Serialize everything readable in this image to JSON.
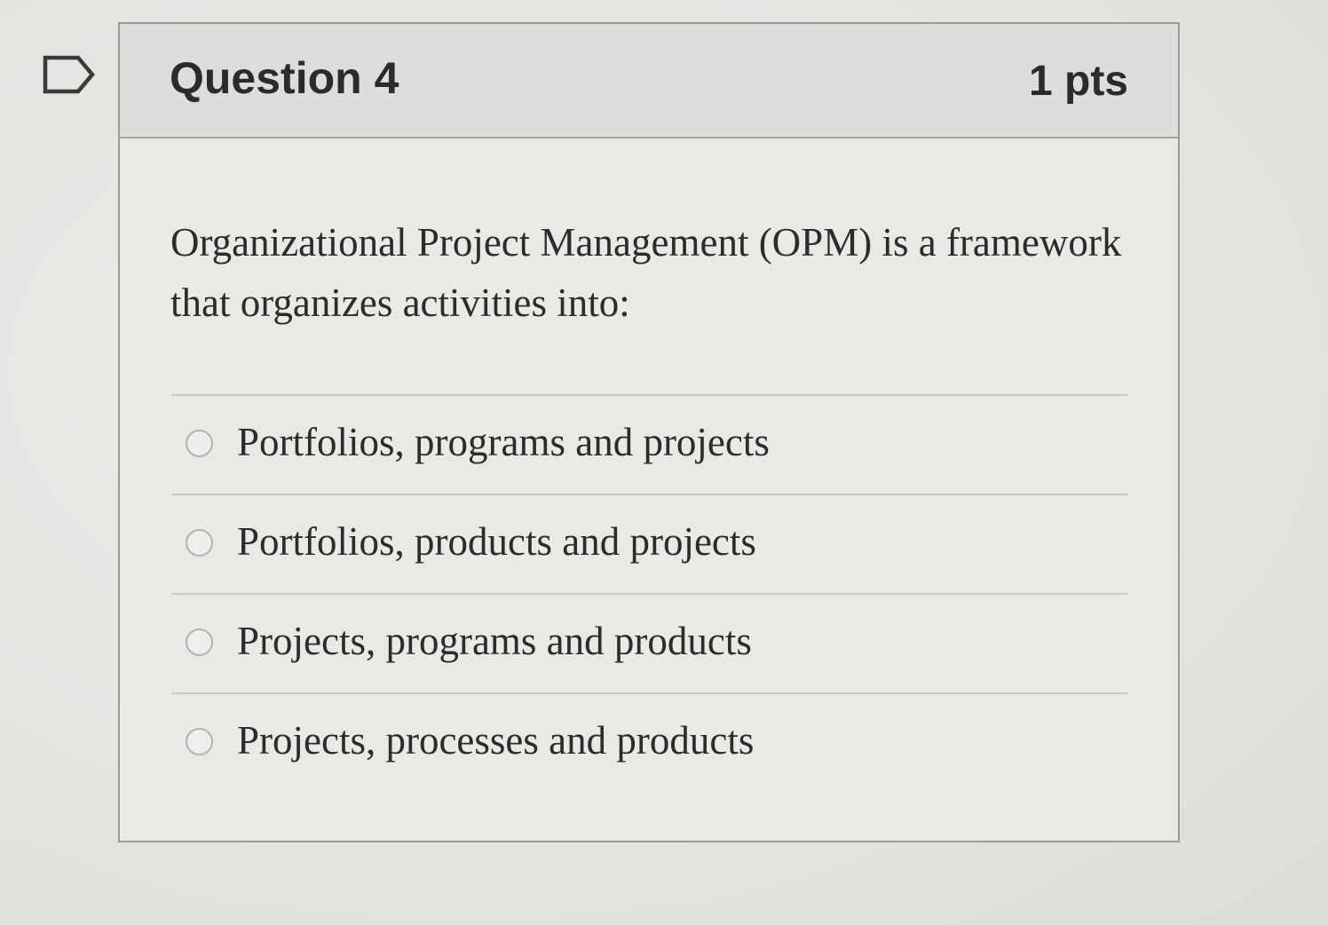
{
  "question": {
    "title": "Question 4",
    "points": "1 pts",
    "text": "Organizational Project Management (OPM) is a framework that organizes activities into:",
    "answers": [
      {
        "label": "Portfolios, programs and projects",
        "selected": false
      },
      {
        "label": "Portfolios, products and projects",
        "selected": false
      },
      {
        "label": "Projects, programs and products",
        "selected": false
      },
      {
        "label": "Projects, processes and products",
        "selected": false
      }
    ]
  },
  "icons": {
    "flag": "flag-question-icon"
  },
  "colors": {
    "header_bg": "#dddddb",
    "card_border": "#9a9a98",
    "text": "#2b2b2b"
  }
}
